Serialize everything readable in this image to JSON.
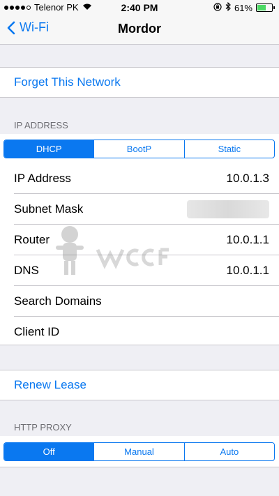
{
  "status_bar": {
    "carrier": "Telenor PK",
    "time": "2:40 PM",
    "battery": "61%",
    "signal_bars_filled": 4,
    "battery_level": 0.61
  },
  "nav": {
    "back_label": "Wi-Fi",
    "title": "Mordor"
  },
  "forget_label": "Forget This Network",
  "ip_section": {
    "header": "IP ADDRESS",
    "segments": [
      "DHCP",
      "BootP",
      "Static"
    ],
    "selected": "DHCP",
    "rows": [
      {
        "label": "IP Address",
        "value": "10.0.1.3"
      },
      {
        "label": "Subnet Mask",
        "value": ""
      },
      {
        "label": "Router",
        "value": "10.0.1.1"
      },
      {
        "label": "DNS",
        "value": "10.0.1.1"
      },
      {
        "label": "Search Domains",
        "value": ""
      },
      {
        "label": "Client ID",
        "value": ""
      }
    ]
  },
  "renew_label": "Renew Lease",
  "proxy_section": {
    "header": "HTTP PROXY",
    "segments": [
      "Off",
      "Manual",
      "Auto"
    ],
    "selected": "Off"
  },
  "colors": {
    "accent": "#0a78f0",
    "background": "#efeff4",
    "battery": "#4cd964"
  }
}
